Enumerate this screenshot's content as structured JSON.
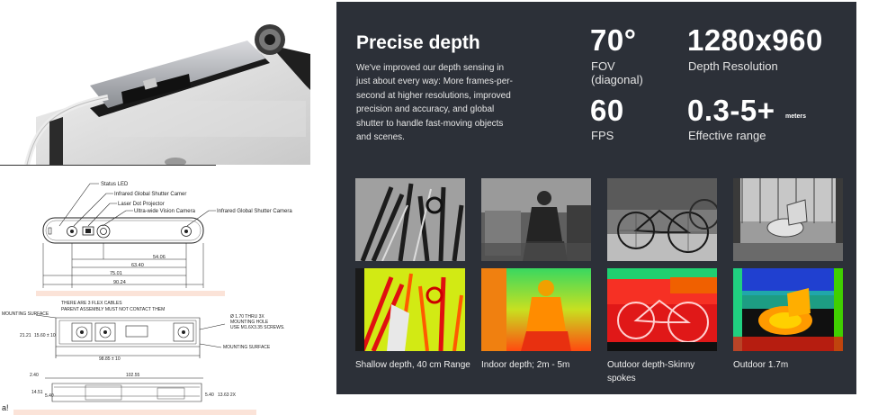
{
  "drawing": {
    "callouts": {
      "status_led": "Status LED",
      "infrared_left": "Infrared Global Shutter Camer",
      "laser_projector": "Laser Dot Projector",
      "ultra_wide": "Ultra-wide Vision Camera",
      "infrared_right": "Infrared Global Shutter Camera"
    },
    "dims_front": [
      "54.06",
      "63.40",
      "75.01",
      "90.24"
    ],
    "side_labels": {
      "flex_cables": "THERE ARE 3 FLEX CABLES",
      "parent_assembly": "PARENT ASSEMBLY MUST NOT CONTACT THEM",
      "mounting_surface_left": "MOUNTING SURFACE",
      "hole_dim": "Ø 1.70 THRU 3X",
      "mounting_hole": "MOUNTING HOLE",
      "screws": "USE M1.6X3.35 SCREWS.",
      "mounting_surface_right": "MOUNTING SURFACE",
      "height_a": "21.21",
      "height_b": "15.60 ± 10",
      "width_total": "98.85 ± 10"
    },
    "bottom_labels": {
      "offset_left": "2.40",
      "width": "102.55",
      "h1": "14.51",
      "h2": "5.40",
      "h3": "5.40",
      "h4": "13.63 2X"
    },
    "stray_char": "a!"
  },
  "panel": {
    "title": "Precise depth",
    "description": "We've improved our depth sensing in just about every way: More frames-per-second at higher resolutions, improved precision and accuracy, and global shutter to handle fast-moving objects and scenes.",
    "stats": {
      "fov_value": "70°",
      "fov_label_1": "FOV",
      "fov_label_2": "(diagonal)",
      "res_value": "1280x960",
      "res_label": "Depth Resolution",
      "fps_value": "60",
      "fps_label": "FPS",
      "range_value": "0.3-5+",
      "range_unit": "meters",
      "range_label": "Effective range"
    },
    "captions": [
      "Shallow depth, 40 cm Range",
      "Indoor depth; 2m - 5m",
      "Outdoor depth-Skinny spokes",
      "Outdoor 1.7m"
    ]
  },
  "colors": {
    "panel_bg": "#2c3038",
    "accent_pink": "#fbe3d8"
  }
}
